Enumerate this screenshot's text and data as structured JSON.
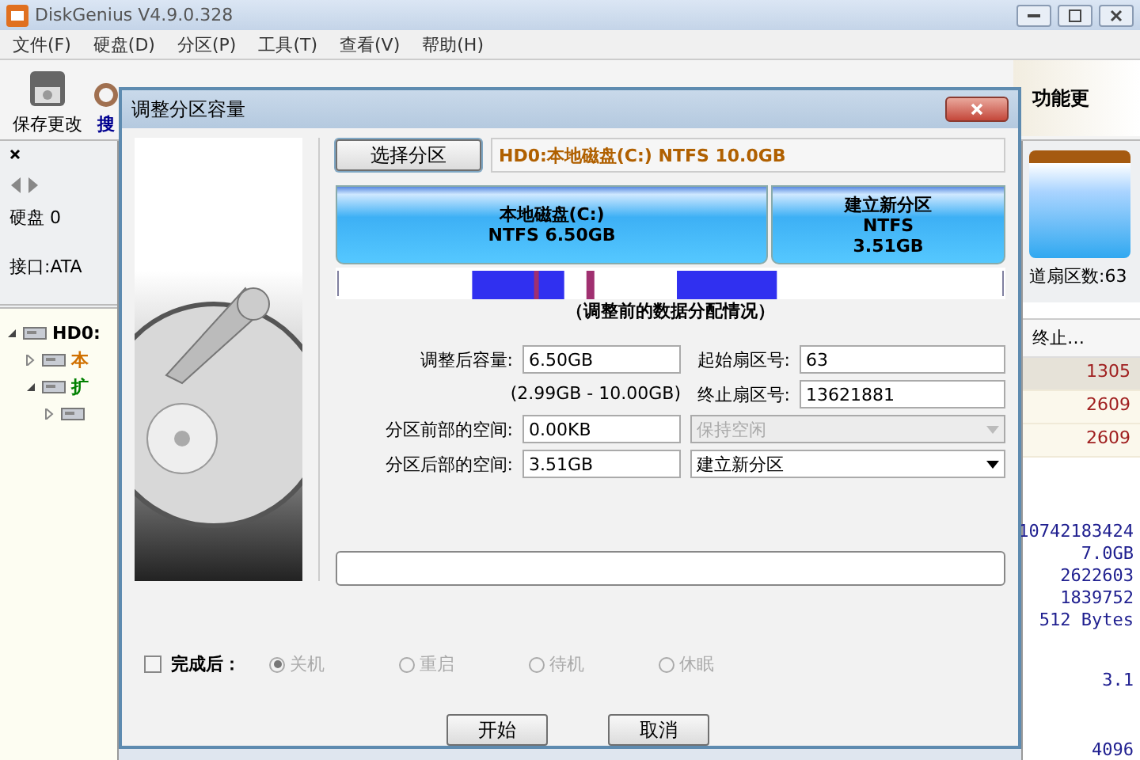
{
  "window": {
    "title": "DiskGenius V4.9.0.328"
  },
  "menu": [
    "文件(F)",
    "硬盘(D)",
    "分区(P)",
    "工具(T)",
    "查看(V)",
    "帮助(H)"
  ],
  "toolbar": {
    "items": [
      {
        "label": "保存更改",
        "kind": "save"
      },
      {
        "label": "搜",
        "kind": "search"
      }
    ],
    "banner": "功能更"
  },
  "disk_panel": {
    "disk": "硬盘 0",
    "interface": "接口:ATA"
  },
  "tree": [
    {
      "label": "HD0:",
      "color": "#000000",
      "expanded": true,
      "children": [
        {
          "label": "本",
          "color": "#d07000",
          "expanded": false
        },
        {
          "label": "扩",
          "color": "#008000",
          "expanded": true,
          "children": [
            {
              "expanded": false
            }
          ]
        }
      ]
    }
  ],
  "right_panel": {
    "sector_count": "道扇区数:63",
    "table": {
      "columns": [
        "终止…"
      ],
      "rows": [
        [
          "1305"
        ],
        [
          "2609"
        ],
        [
          "2609"
        ]
      ]
    },
    "info": [
      "10742183424",
      "7.0GB",
      "2622603",
      "1839752",
      "512 Bytes"
    ],
    "version": "3.1",
    "bottom_value": "4096"
  },
  "dialog": {
    "title": "调整分区容量",
    "select_button": "选择分区",
    "selected_partition": "HD0:本地磁盘(C:) NTFS 10.0GB",
    "partitions": [
      {
        "label": "本地磁盘(C:)",
        "details": [
          "NTFS 6.50GB"
        ]
      },
      {
        "label": "建立新分区",
        "details": [
          "NTFS",
          "3.51GB"
        ]
      }
    ],
    "distribution_caption": "（调整前的数据分配情况）",
    "size": {
      "label": "调整后容量:",
      "value": "6.50GB",
      "range": "(2.99GB - 10.00GB)"
    },
    "start_sector": {
      "label": "起始扇区号:",
      "value": "63"
    },
    "end_sector": {
      "label": "终止扇区号:",
      "value": "13621881"
    },
    "space_before": {
      "label": "分区前部的空间:",
      "value": "0.00KB",
      "action": "保持空闲",
      "disabled": true
    },
    "space_after": {
      "label": "分区后部的空间:",
      "value": "3.51GB",
      "action": "建立新分区",
      "disabled": false
    },
    "progress": {
      "level": 0
    },
    "after_completion": {
      "label": "完成后：",
      "checked": false,
      "options": [
        {
          "label": "关机",
          "selected": true,
          "disabled": true
        },
        {
          "label": "重启",
          "selected": false,
          "disabled": true
        },
        {
          "label": "待机",
          "selected": false,
          "disabled": true
        },
        {
          "label": "休眠",
          "selected": false,
          "disabled": true
        }
      ]
    },
    "buttons": [
      "开始",
      "取消"
    ]
  }
}
